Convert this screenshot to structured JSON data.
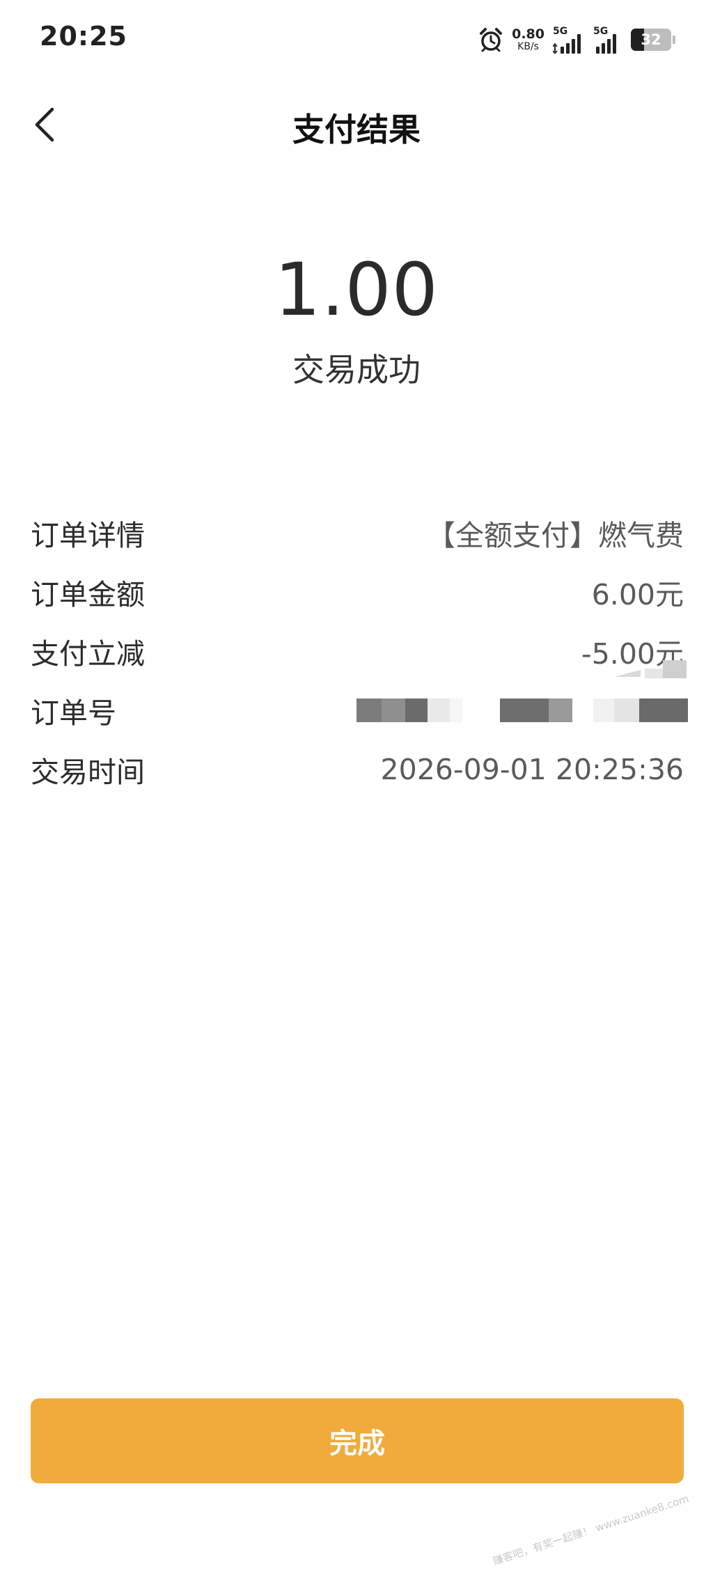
{
  "status_bar": {
    "time": "20:25",
    "net_speed_value": "0.80",
    "net_speed_unit": "KB/s",
    "sim1_network": "5G",
    "sim2_network": "5G",
    "battery_level": "32",
    "icons": [
      "alarm-icon",
      "signal-icon",
      "battery-icon"
    ]
  },
  "header": {
    "title": "支付结果"
  },
  "payment": {
    "amount": "1.00",
    "status": "交易成功"
  },
  "details": [
    {
      "label": "订单详情",
      "value": "【全额支付】燃气费"
    },
    {
      "label": "订单金额",
      "value": "6.00元"
    },
    {
      "label": "支付立减",
      "value": "-5.00元"
    },
    {
      "label": "订单号",
      "value": ""
    },
    {
      "label": "交易时间",
      "value": "2026-09-01 20:25:36"
    }
  ],
  "footer": {
    "done_label": "完成"
  },
  "watermark": "赚客吧，有奖一起赚！ www.zuanke8.com",
  "colors": {
    "accent": "#f0ab3b",
    "background": "#ffffff",
    "text_primary": "#2c2c2c",
    "text_secondary": "#5a5a5a"
  }
}
